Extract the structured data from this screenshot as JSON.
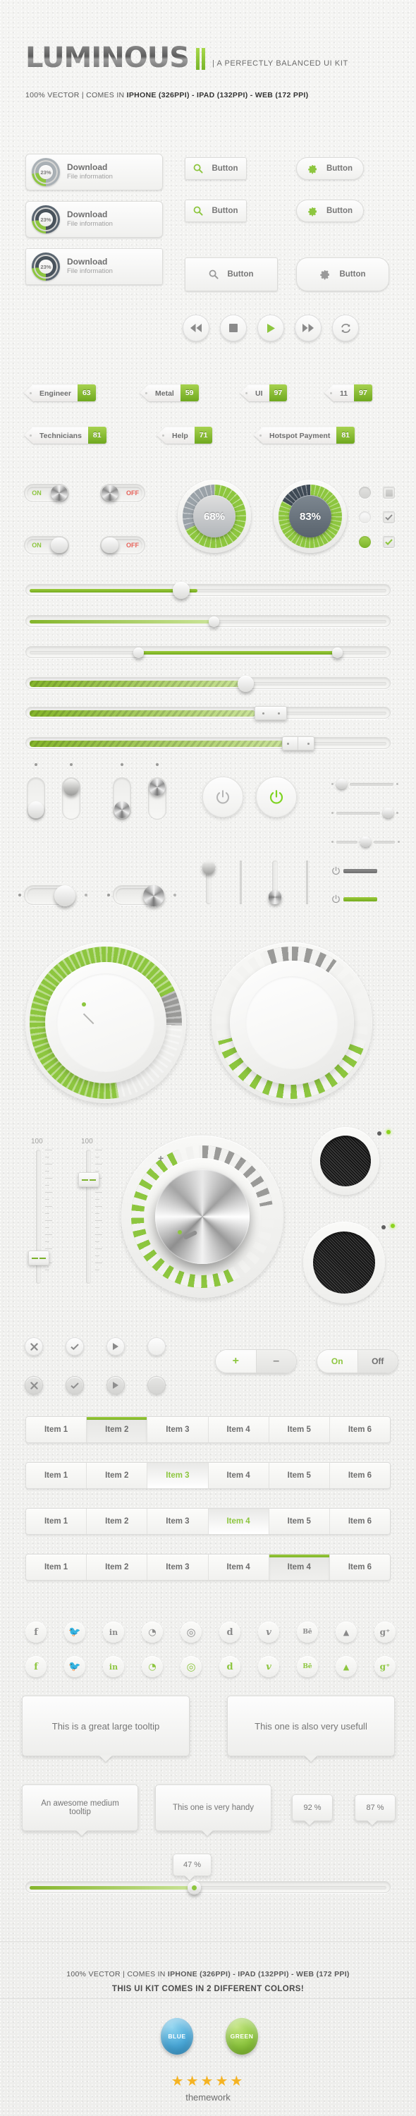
{
  "header": {
    "logo": "LUMINOUS",
    "tagline": "|  A PERFECTLY BALANCED UI KIT",
    "subline_prefix": "100% VECTOR | COMES IN ",
    "subline_bold": "IPHONE (326PPI) - IPAD (132PPI) - WEB (172 PPI)"
  },
  "download_cards": [
    {
      "percent": "23%",
      "title": "Download",
      "subtitle": "File information"
    },
    {
      "percent": "23%",
      "title": "Download",
      "subtitle": "File information"
    },
    {
      "percent": "23%",
      "title": "Download",
      "subtitle": "File information"
    }
  ],
  "icon_buttons": [
    {
      "icon": "search-icon",
      "label": "Button",
      "shape": "rounded"
    },
    {
      "icon": "gear-icon",
      "label": "Button",
      "shape": "pill"
    },
    {
      "icon": "search-icon",
      "label": "Button",
      "shape": "rounded"
    },
    {
      "icon": "gear-icon",
      "label": "Button",
      "shape": "pill"
    },
    {
      "icon": "search-icon",
      "label": "Button",
      "shape": "square"
    },
    {
      "icon": "gear-icon",
      "label": "Button",
      "shape": "pill"
    }
  ],
  "media_buttons": [
    {
      "icon": "rewind-icon"
    },
    {
      "icon": "stop-icon"
    },
    {
      "icon": "play-icon"
    },
    {
      "icon": "fast-forward-icon"
    },
    {
      "icon": "refresh-icon"
    }
  ],
  "tags": [
    {
      "label": "Engineer",
      "value": "63"
    },
    {
      "label": "Metal",
      "value": "59"
    },
    {
      "label": "UI",
      "value": "97"
    },
    {
      "label": "11",
      "value": "97"
    },
    {
      "label": "Technicians",
      "value": "81"
    },
    {
      "label": "Help",
      "value": "71"
    },
    {
      "label": "Hotspot Payment",
      "value": "81"
    }
  ],
  "switches": [
    {
      "on_label": "ON",
      "off_label": "OFF",
      "state": "on",
      "knob": "metal"
    },
    {
      "on_label": "ON",
      "off_label": "OFF",
      "state": "off",
      "knob": "metal"
    },
    {
      "on_label": "ON",
      "off_label": "OFF",
      "state": "on",
      "knob": "plain"
    },
    {
      "on_label": "ON",
      "off_label": "OFF",
      "state": "off",
      "knob": "plain"
    }
  ],
  "gauges": [
    {
      "value": "68%",
      "pct": 68
    },
    {
      "value": "83%",
      "pct": 83
    }
  ],
  "sliders": [
    {
      "fill_pct": 48,
      "style": "solid",
      "handle": "large"
    },
    {
      "fill_pct": 62,
      "style": "pale",
      "handle": "small"
    },
    {
      "fill_pct": 100,
      "range_start": 26,
      "range_end": 75,
      "style": "solid",
      "handle": "range"
    },
    {
      "fill_pct": 72,
      "style": "stripe",
      "handle": "large"
    },
    {
      "fill_pct": 74,
      "style": "stripe",
      "handle": "rect"
    },
    {
      "fill_pct": 85,
      "style": "stripe",
      "handle": "rect-split"
    }
  ],
  "power_buttons": [
    {
      "icon": "power-icon",
      "state": "off"
    },
    {
      "icon": "power-icon",
      "state": "on"
    }
  ],
  "faders": [
    {
      "label": "100",
      "value_pos": 78
    },
    {
      "label": "100",
      "value_pos": 20
    }
  ],
  "metal_knob": {
    "plus": "+",
    "minus": "-"
  },
  "round_icon_buttons": [
    {
      "icon": "close-icon",
      "state": "light"
    },
    {
      "icon": "check-icon",
      "state": "light"
    },
    {
      "icon": "play-icon",
      "state": "light"
    },
    {
      "icon": "blank-icon",
      "state": "light"
    },
    {
      "icon": "close-icon",
      "state": "dark"
    },
    {
      "icon": "check-icon",
      "state": "dark"
    },
    {
      "icon": "play-icon",
      "state": "dark"
    },
    {
      "icon": "blank-icon",
      "state": "dark"
    }
  ],
  "segment_controls": [
    {
      "a": "+",
      "b": "–",
      "a_color": "#8dc63f",
      "b_color": "#8a8a8a"
    },
    {
      "a": "On",
      "b": "Off",
      "a_color": "#8dc63f",
      "b_color": "#6e6e6e"
    }
  ],
  "tab_bars": [
    {
      "items": [
        "Item 1",
        "Item 2",
        "Item 3",
        "Item 4",
        "Item 5",
        "Item 6"
      ],
      "active": 1,
      "style": "grey"
    },
    {
      "items": [
        "Item 1",
        "Item 2",
        "Item 3",
        "Item 4",
        "Item 5",
        "Item 6"
      ],
      "active": 2,
      "style": "white"
    },
    {
      "items": [
        "Item 1",
        "Item 2",
        "Item 3",
        "Item 4",
        "Item 5",
        "Item 6"
      ],
      "active": 3,
      "style": "white"
    },
    {
      "items": [
        "Item 1",
        "Item 2",
        "Item 3",
        "Item 4",
        "Item 4",
        "Item 6"
      ],
      "active": 4,
      "style": "grey"
    }
  ],
  "social_icons": [
    {
      "name": "facebook-icon",
      "glyph": "f"
    },
    {
      "name": "twitter-icon",
      "glyph": "🐦"
    },
    {
      "name": "linkedin-icon",
      "glyph": "in"
    },
    {
      "name": "rss-icon",
      "glyph": "◔"
    },
    {
      "name": "dribbble-icon",
      "glyph": "◎"
    },
    {
      "name": "digg-icon",
      "glyph": "d"
    },
    {
      "name": "vimeo-icon",
      "glyph": "v"
    },
    {
      "name": "behance-icon",
      "glyph": "Bē"
    },
    {
      "name": "forrst-icon",
      "glyph": "▲"
    },
    {
      "name": "googleplus-icon",
      "glyph": "g⁺"
    }
  ],
  "tooltips": [
    {
      "text": "This is a great large tooltip",
      "size": "large"
    },
    {
      "text": "This one is also very usefull",
      "size": "large"
    },
    {
      "text": "An awesome medium tooltip",
      "size": "medium"
    },
    {
      "text": "This one is very handy",
      "size": "medium"
    },
    {
      "text": "92 %",
      "size": "small"
    },
    {
      "text": "87 %",
      "size": "small"
    },
    {
      "text": "47 %",
      "size": "small"
    }
  ],
  "bottom_slider": {
    "fill_pct": 47,
    "tooltip": "47 %"
  },
  "footer": {
    "subline_prefix": "100% VECTOR | COMES IN ",
    "subline_bold": "IPHONE (326PPI) - IPAD (132PPI) - WEB (172 PPI)",
    "colors_heading": "THIS UI KIT COMES IN 2 DIFFERENT COLORS!",
    "balls": [
      {
        "label": "BLUE",
        "color": "#4aa8d8"
      },
      {
        "label": "GREEN",
        "color": "#8dc63f"
      }
    ],
    "stars": "★★★★★",
    "brand": "themework"
  },
  "palette": {
    "green": "#8dc63f",
    "green_dark": "#74ab1f",
    "blue": "#4aa8d8",
    "grey_text": "#6e6e6e",
    "bg": "#f2f2f0"
  }
}
